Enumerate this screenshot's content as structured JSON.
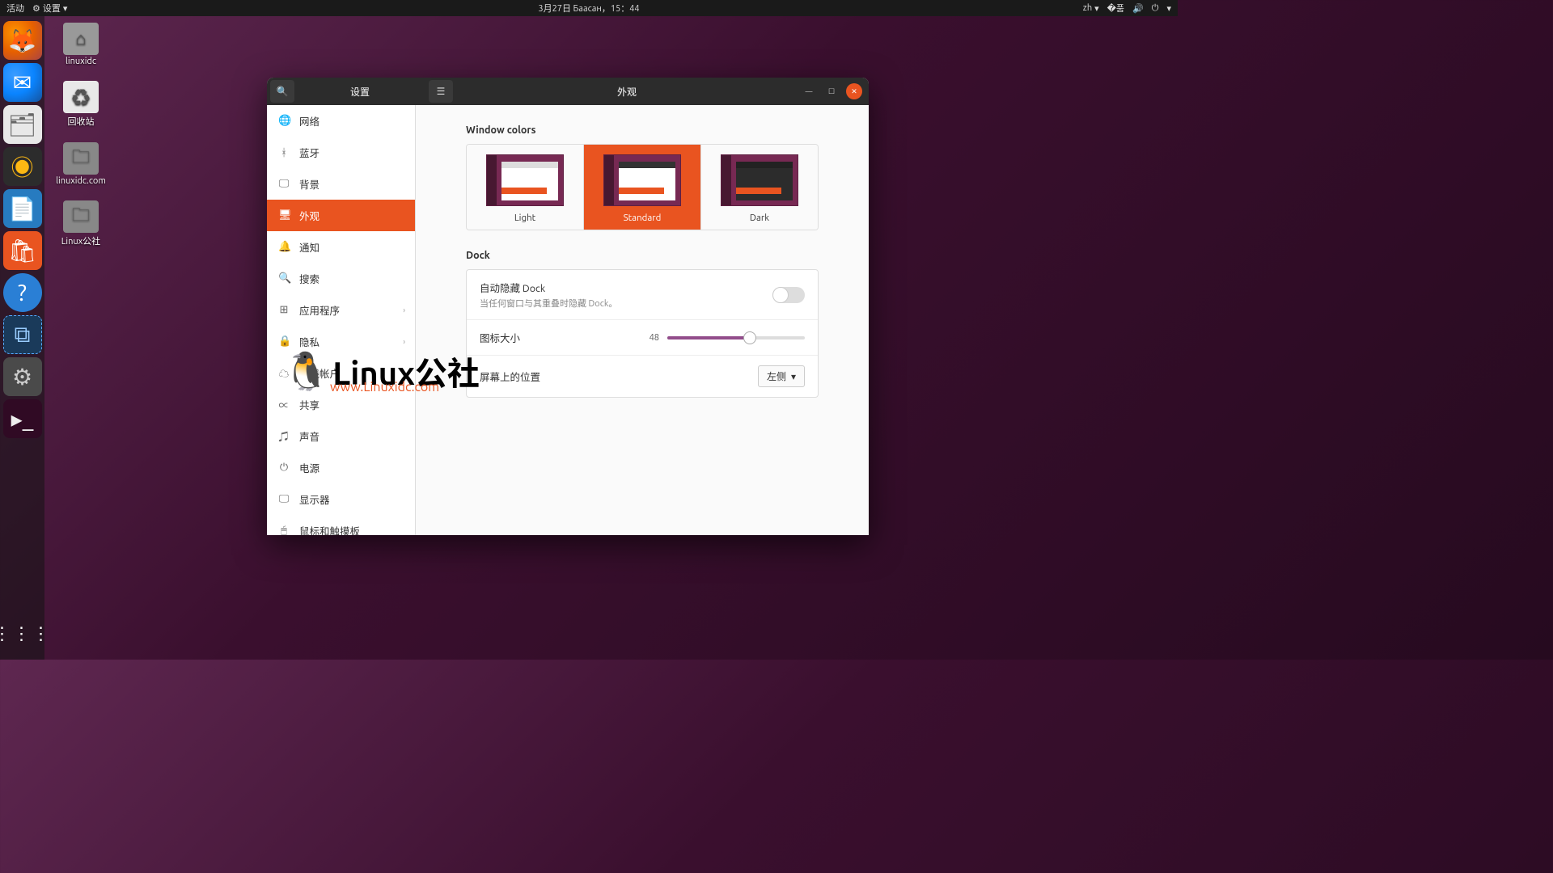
{
  "topbar": {
    "activities": "活动",
    "app_indicator": "设置",
    "datetime": "3月27日 Баасан，15：44",
    "lang": "zh"
  },
  "desktop": {
    "icons": [
      {
        "label": "linuxidc"
      },
      {
        "label": "回收站"
      },
      {
        "label": "linuxidc.com"
      },
      {
        "label": "Linux公社"
      }
    ]
  },
  "window": {
    "app_title": "设置",
    "page_title": "外观"
  },
  "sidebar": {
    "items": [
      {
        "icon": "🌐",
        "label": "网络"
      },
      {
        "icon": "ᚼ",
        "label": "蓝牙"
      },
      {
        "icon": "🖵",
        "label": "背景"
      },
      {
        "icon": "🖥",
        "label": "外观",
        "active": true
      },
      {
        "icon": "🔔",
        "label": "通知"
      },
      {
        "icon": "🔍",
        "label": "搜索"
      },
      {
        "icon": "⊞",
        "label": "应用程序",
        "chevron": true
      },
      {
        "icon": "🔒",
        "label": "隐私",
        "chevron": true
      },
      {
        "icon": "☁",
        "label": "在线帐户"
      },
      {
        "icon": "∝",
        "label": "共享"
      },
      {
        "icon": "♫",
        "label": "声音"
      },
      {
        "icon": "⏻",
        "label": "电源"
      },
      {
        "icon": "🖵",
        "label": "显示器"
      },
      {
        "icon": "🖱",
        "label": "鼠标和触摸板"
      }
    ]
  },
  "appearance": {
    "window_colors_title": "Window colors",
    "themes": [
      {
        "name": "Light",
        "selected": false
      },
      {
        "name": "Standard",
        "selected": true
      },
      {
        "name": "Dark",
        "selected": false
      }
    ],
    "dock_title": "Dock",
    "autohide": {
      "label": "自动隐藏 Dock",
      "sub": "当任何窗口与其重叠时隐藏 Dock。",
      "value": false
    },
    "icon_size": {
      "label": "图标大小",
      "value": 48
    },
    "position": {
      "label": "屏幕上的位置",
      "value": "左侧"
    }
  },
  "watermark": {
    "main": "Linux公社",
    "sub": "www.Linuxidc.com"
  }
}
